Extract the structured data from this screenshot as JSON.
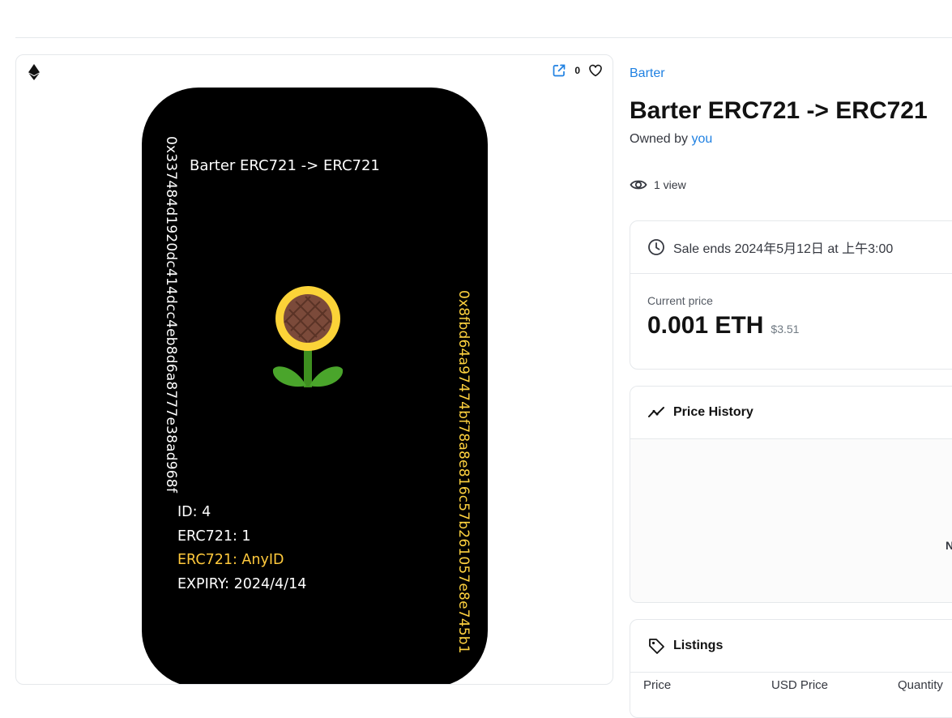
{
  "nft_card": {
    "favorite_count": "0",
    "title": "Barter ERC721 -> ERC721",
    "address_left": "0x337484d1920dc414dcc4eb8d6a8777e38ad968f",
    "address_right": "0x8fbd64a97474bf78a8e816c57b261057e8e745b1",
    "id_line": "ID: 4",
    "erc_line": "ERC721: 1",
    "any_line": "ERC721: AnyID",
    "expiry_line": "EXPIRY: 2024/4/14",
    "accent_color": "#ffc93c",
    "background_color": "#000000"
  },
  "item": {
    "collection": "Barter",
    "title": "Barter ERC721 -> ERC721",
    "owned_prefix": "Owned by",
    "owner": "you",
    "views": "1 view"
  },
  "sale": {
    "ends_text": "Sale ends 2024年5月12日 at 上午3:00",
    "price_label": "Current price",
    "price_eth": "0.001 ETH",
    "price_usd": "$3.51"
  },
  "price_history": {
    "title": "Price History",
    "no_data_partial": "N"
  },
  "listings": {
    "title": "Listings",
    "columns": [
      "Price",
      "USD Price",
      "Quantity"
    ]
  },
  "colors": {
    "link": "#2081e2",
    "border": "#e5e8eb"
  },
  "icons": {
    "chain": "ethereum-icon",
    "external": "external-link-icon",
    "favorite": "heart-icon",
    "views": "eye-icon",
    "sale": "clock-icon",
    "history": "trending-icon",
    "listings": "tag-icon",
    "image": "sunflower-icon"
  }
}
